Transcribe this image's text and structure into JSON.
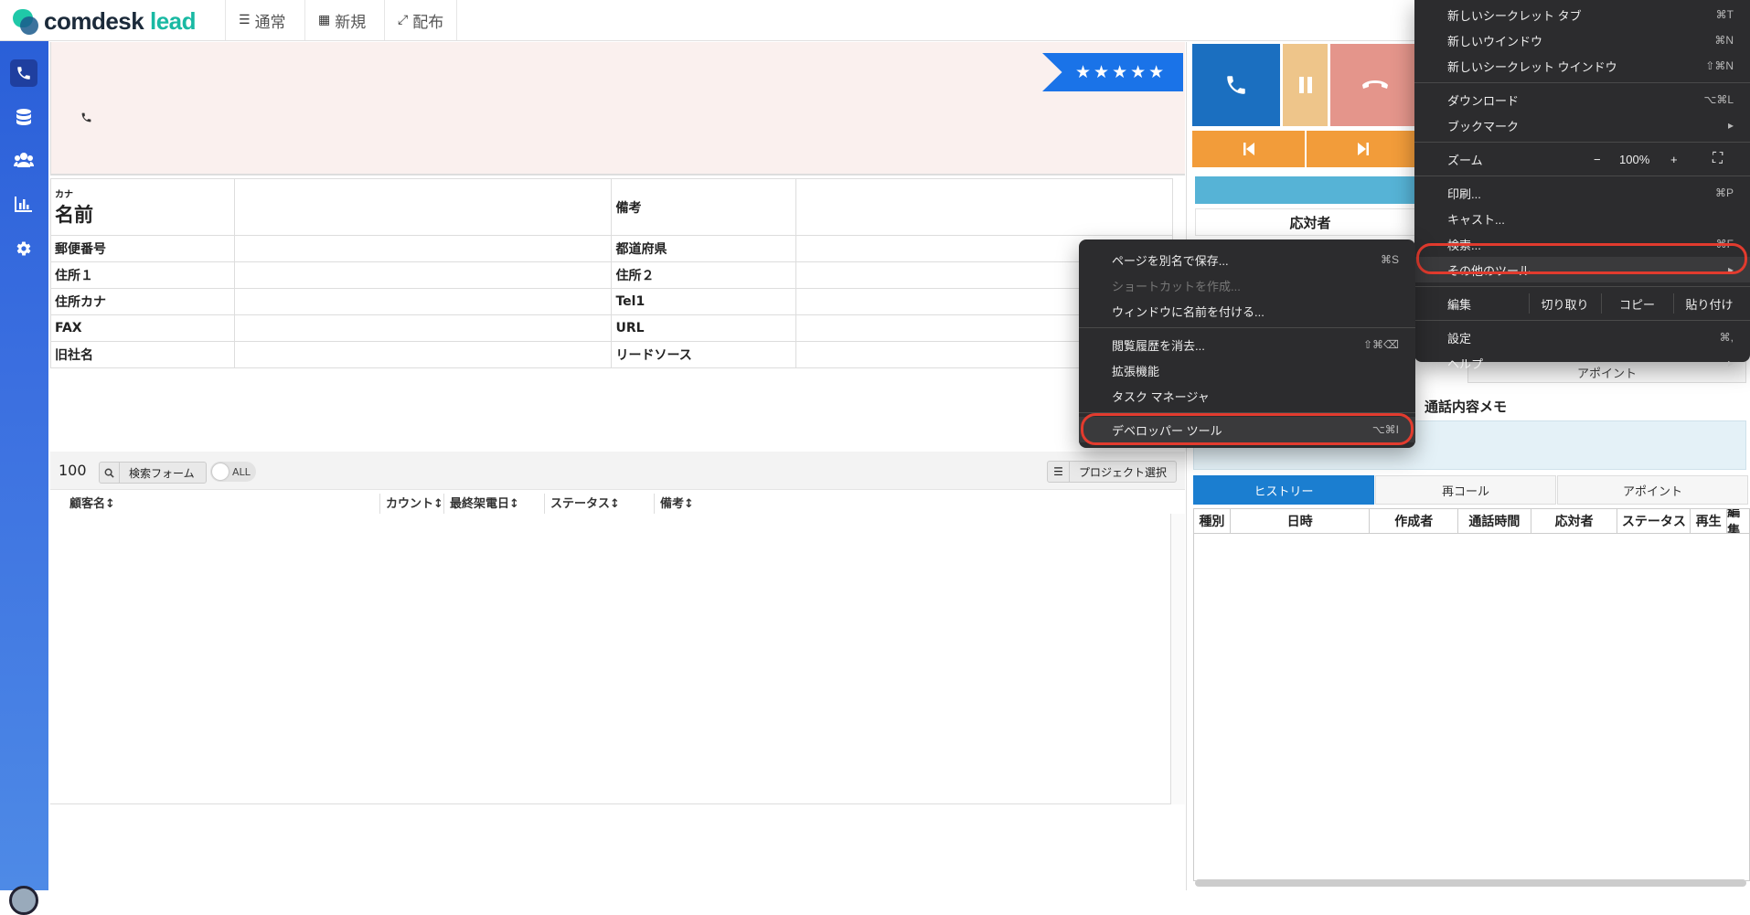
{
  "app": {
    "logo_main": "comdesk",
    "logo_accent": "lead"
  },
  "topnav": [
    {
      "icon": "list-icon",
      "glyph": "☰",
      "label": "通常"
    },
    {
      "icon": "grid-icon",
      "glyph": "▦",
      "label": "新規"
    },
    {
      "icon": "expand-icon",
      "glyph": "⤢",
      "label": "配布"
    }
  ],
  "header": {
    "rating_stars": "★★★★★"
  },
  "info": {
    "kana": "カナ",
    "name": "名前",
    "memo": "備考",
    "zip": "郵便番号",
    "pref": "都道府県",
    "addr1": "住所１",
    "addr2": "住所２",
    "addr_kana": "住所カナ",
    "tel1": "Tel1",
    "fax": "FAX",
    "url": "URL",
    "old_name": "旧社名",
    "lead_source": "リードソース"
  },
  "list": {
    "count": "100",
    "search_label": "検索フォーム",
    "toggle_label": "ALL",
    "project_label": "プロジェクト選択",
    "columns": [
      "顧客名↕",
      "カウント↕",
      "最終架電日↕",
      "ステータス↕",
      "備考↕"
    ]
  },
  "right": {
    "responder": "応対者",
    "appoint": "アポイント",
    "memo_title": "通話内容メモ",
    "tabs": [
      "ヒストリー",
      "再コール",
      "アポイント"
    ],
    "history_cols": [
      "種別",
      "日時",
      "作成者",
      "通話時間",
      "応対者",
      "ステータス",
      "再生",
      "編集"
    ]
  },
  "chrome_menu": {
    "items_top": [
      {
        "label": "新しいシークレット タブ",
        "shortcut": "⌘T"
      },
      {
        "label": "新しいウインドウ",
        "shortcut": "⌘N"
      },
      {
        "label": "新しいシークレット ウインドウ",
        "shortcut": "⇧⌘N"
      }
    ],
    "download": {
      "label": "ダウンロード",
      "shortcut": "⌥⌘L"
    },
    "bookmarks": {
      "label": "ブックマーク",
      "arrow": "▸"
    },
    "zoom": {
      "label": "ズーム",
      "minus": "−",
      "value": "100%",
      "plus": "+",
      "fullscreen": "⛶"
    },
    "print": {
      "label": "印刷...",
      "shortcut": "⌘P"
    },
    "cast": {
      "label": "キャスト..."
    },
    "find": {
      "label": "検索...",
      "shortcut": "⌘F"
    },
    "more_tools": {
      "label": "その他のツール",
      "arrow": "▸"
    },
    "edit": {
      "label": "編集",
      "cut": "切り取り",
      "copy": "コピー",
      "paste": "貼り付け"
    },
    "settings": {
      "label": "設定",
      "shortcut": "⌘,"
    },
    "help": {
      "label": "ヘルプ",
      "arrow": "▸"
    }
  },
  "sub_menu": {
    "save_as": {
      "label": "ページを別名で保存...",
      "shortcut": "⌘S"
    },
    "shortcut": {
      "label": "ショートカットを作成..."
    },
    "name_window": {
      "label": "ウィンドウに名前を付ける..."
    },
    "clear_history": {
      "label": "閲覧履歴を消去...",
      "shortcut": "⇧⌘⌫"
    },
    "extensions": {
      "label": "拡張機能"
    },
    "task_manager": {
      "label": "タスク マネージャ"
    },
    "devtools": {
      "label": "デベロッパー ツール",
      "shortcut": "⌥⌘I"
    }
  },
  "colors": {
    "accent": "#1a73e8",
    "sidebar_top": "#2a5fd8",
    "highlight_ring": "#e23b2e",
    "menu_bg": "#2c2c2e"
  }
}
